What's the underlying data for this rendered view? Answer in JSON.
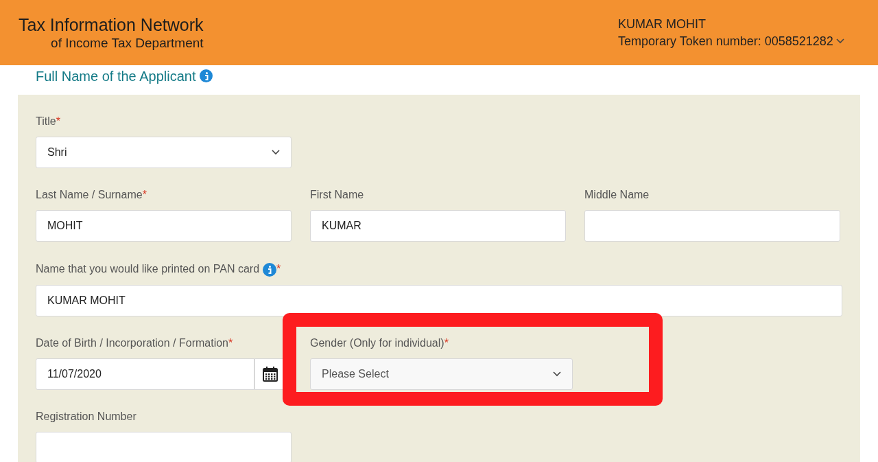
{
  "header": {
    "org_name": "Tax Information Network",
    "org_subtitle": "of Income Tax Department",
    "user_name": "KUMAR MOHIT",
    "token": "Temporary Token number: 0058521282"
  },
  "section_title": "Full Name of the Applicant",
  "form_rows": [
    [
      {
        "kind": "select",
        "label": "Title",
        "required_mark": "*",
        "value": "Shri"
      }
    ],
    [
      {
        "kind": "text",
        "label": "Last Name / Surname",
        "required_mark": "*",
        "value": "MOHIT"
      },
      {
        "kind": "text",
        "label": "First Name",
        "value": "KUMAR"
      },
      {
        "kind": "text",
        "label": "Middle Name"
      }
    ],
    [
      {
        "kind": "wide",
        "label": "Name that you would like printed on PAN card",
        "info": true,
        "required_mark": "*",
        "value": "KUMAR MOHIT"
      }
    ],
    [
      {
        "kind": "date",
        "label": "Date of Birth / Incorporation / Formation",
        "required_mark": "*",
        "value": "11/07/2020"
      },
      {
        "kind": "select",
        "label": "Gender (Only for individual)",
        "required_mark": "*",
        "placeholder": "Please Select",
        "highlighted": true
      }
    ],
    [
      {
        "kind": "text",
        "label": "Registration Number"
      }
    ]
  ]
}
